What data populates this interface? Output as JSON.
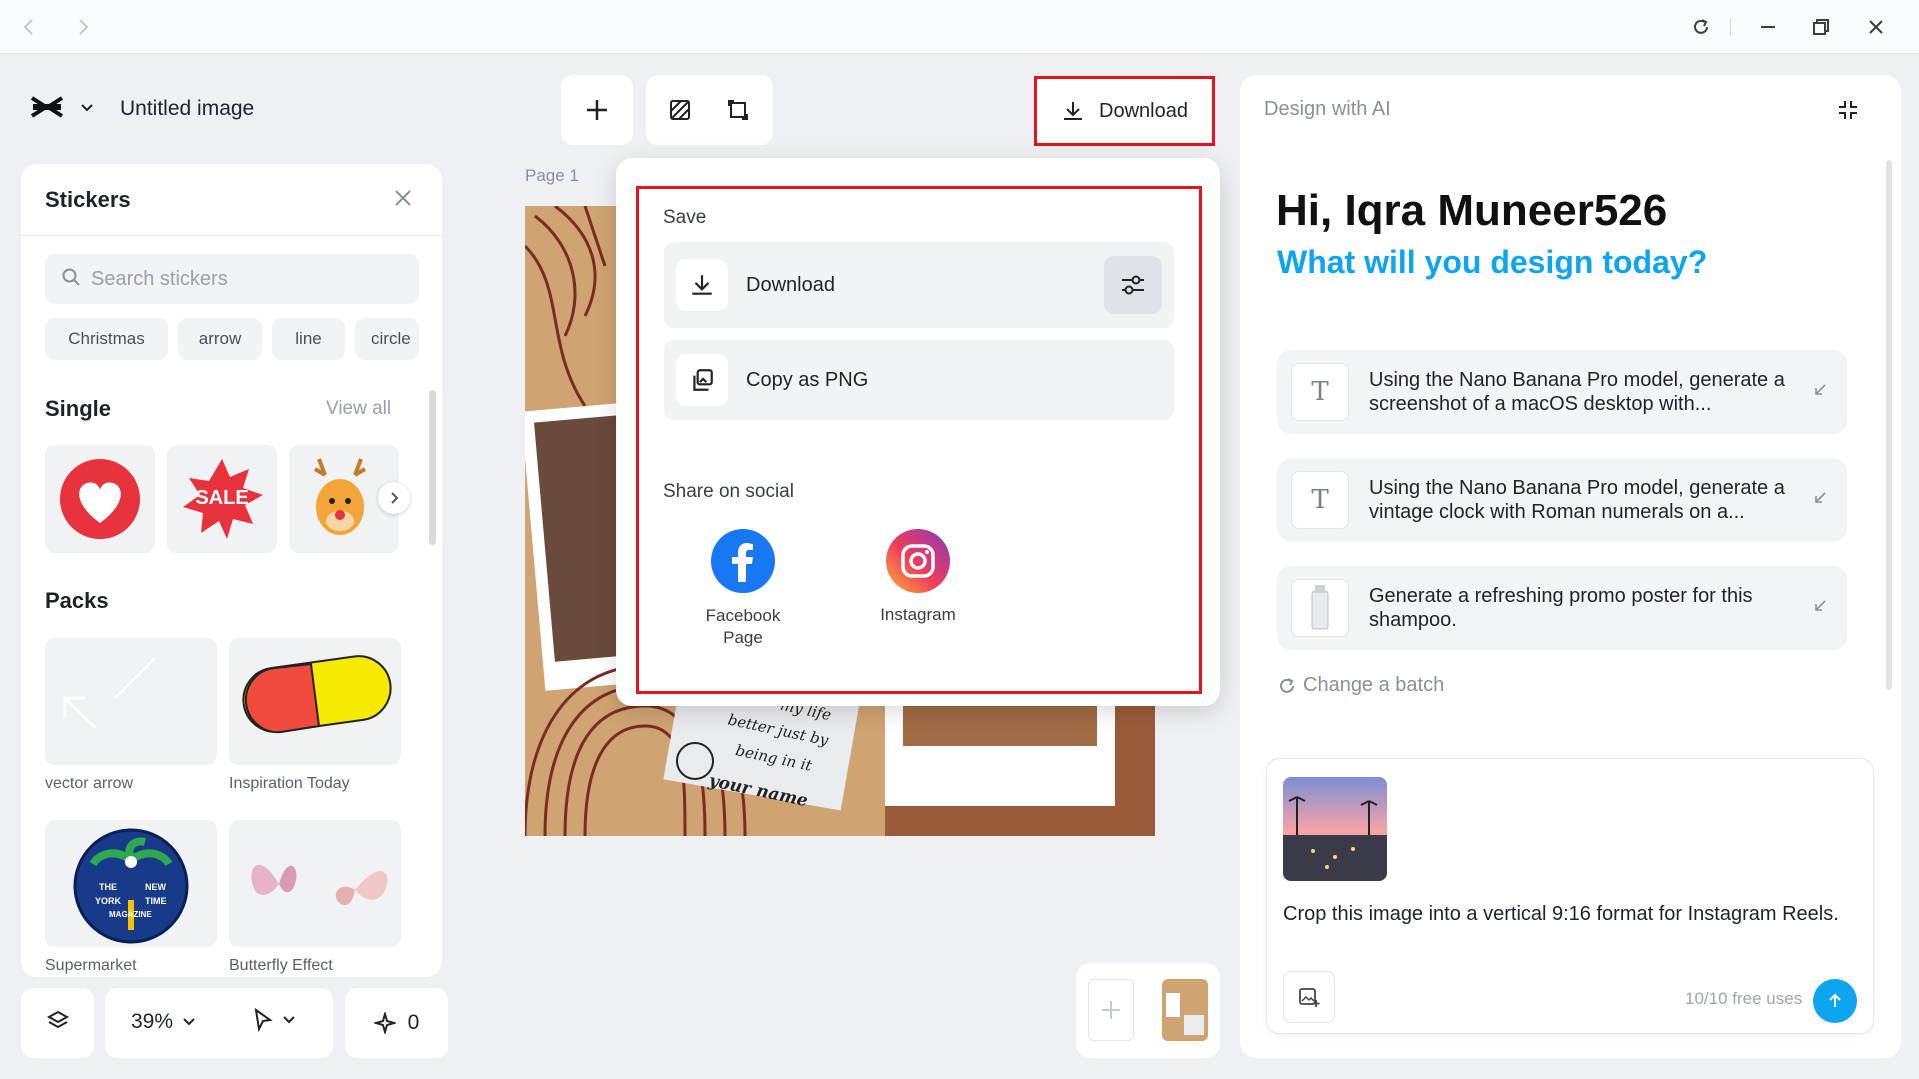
{
  "app": {
    "project_title": "Untitled image"
  },
  "stickers": {
    "title": "Stickers",
    "search_placeholder": "Search stickers",
    "tags": [
      "Christmas",
      "arrow",
      "line",
      "circle"
    ],
    "single_heading": "Single",
    "view_all": "View all",
    "sale_text": "SALE",
    "packs_heading": "Packs",
    "packs": [
      "vector arrow",
      "Inspiration Today",
      "Supermarket",
      "Butterfly Effect"
    ],
    "magazine_text": [
      "THE",
      "NEW",
      "YORK",
      "TIME",
      "MAGAZINE"
    ]
  },
  "bottom_bar": {
    "zoom": "39%",
    "ai_count": "0"
  },
  "canvas": {
    "page_label": "Page 1",
    "note_lines": [
      "my life",
      "better just by",
      "being in it",
      "your name"
    ]
  },
  "toolbar": {
    "download_label": "Download"
  },
  "download_menu": {
    "save_heading": "Save",
    "download_label": "Download",
    "copy_label": "Copy as PNG",
    "share_heading": "Share on social",
    "facebook_label": "Facebook Page",
    "instagram_label": "Instagram"
  },
  "ai_panel": {
    "title": "Design with AI",
    "greeting": "Hi, Iqra Muneer526",
    "subtitle": "What will you design today?",
    "prompts": [
      "Using the Nano Banana Pro model, generate a screenshot of a macOS desktop with...",
      "Using the Nano Banana Pro model, generate a vintage clock with Roman numerals on a...",
      "Generate a refreshing promo poster for this shampoo."
    ],
    "change_batch": "Change a batch",
    "input_text": "Crop this image into a vertical 9:16 format for Instagram Reels.",
    "free_uses": "10/10 free uses"
  },
  "colors": {
    "accent": "#0ea5f0",
    "highlight": "#e3141b",
    "facebook": "#1877f2"
  }
}
